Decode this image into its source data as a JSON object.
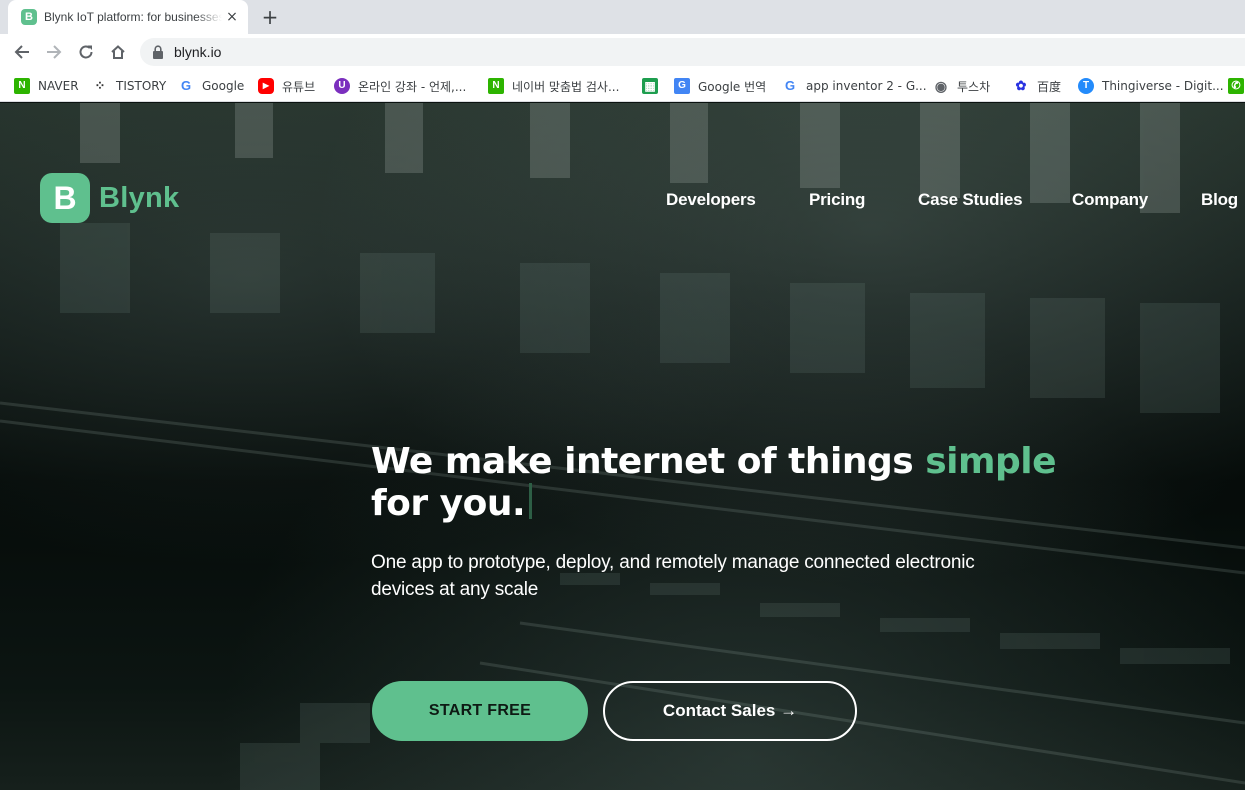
{
  "browser": {
    "tab": {
      "title": "Blynk IoT platform: for businesses and developers",
      "favicon_letter": "B",
      "close_icon": "×"
    },
    "new_tab_icon": "+",
    "url": "blynk.io",
    "bookmarks": [
      {
        "label": "NAVER",
        "icon": "naver-icon",
        "glyph": "N",
        "color": "#2db400"
      },
      {
        "label": "TISTORY",
        "icon": "tistory-icon",
        "glyph": "⁘",
        "color": "#333333"
      },
      {
        "label": "Google",
        "icon": "google-icon",
        "glyph": "G",
        "color": "#4285f4"
      },
      {
        "label": "유튜브",
        "icon": "youtube-icon",
        "glyph": "▶",
        "color": "#ff0000"
      },
      {
        "label": "온라인 강좌 - 언제,...",
        "icon": "online-course-icon",
        "glyph": "U",
        "color": "#7b2fbe"
      },
      {
        "label": "네이버 맞춤법 검사...",
        "icon": "naver-icon",
        "glyph": "N",
        "color": "#2db400"
      },
      {
        "label": "",
        "icon": "sheets-icon",
        "glyph": "▦",
        "color": "#1e9e4f"
      },
      {
        "label": "Google 번역",
        "icon": "google-translate-icon",
        "glyph": "G",
        "color": "#4285f4"
      },
      {
        "label": "app inventor 2 - G...",
        "icon": "google-icon",
        "glyph": "G",
        "color": "#4285f4"
      },
      {
        "label": "투스차",
        "icon": "globe-icon",
        "glyph": "◉",
        "color": "#5f6368"
      },
      {
        "label": "百度",
        "icon": "baidu-icon",
        "glyph": "✿",
        "color": "#2932e1"
      },
      {
        "label": "Thingiverse - Digit...",
        "icon": "thingiverse-icon",
        "glyph": "T",
        "color": "#248bfb"
      },
      {
        "label": "",
        "icon": "phone-icon",
        "glyph": "✆",
        "color": "#2db400"
      }
    ]
  },
  "page": {
    "logo": {
      "mark": "B",
      "text": "Blynk"
    },
    "nav": [
      "Developers",
      "Pricing",
      "Case Studies",
      "Company",
      "Blog"
    ],
    "headline": {
      "main": "We make internet of things ",
      "accent": "simple",
      "rest": "for you."
    },
    "subtitle": "One app to prototype, deploy, and remotely manage connected electronic devices at any scale",
    "cta_primary": "START FREE",
    "cta_secondary": "Contact Sales →",
    "colors": {
      "brand": "#5fc08e",
      "text": "#ffffff",
      "bg": "#0b1210"
    }
  }
}
